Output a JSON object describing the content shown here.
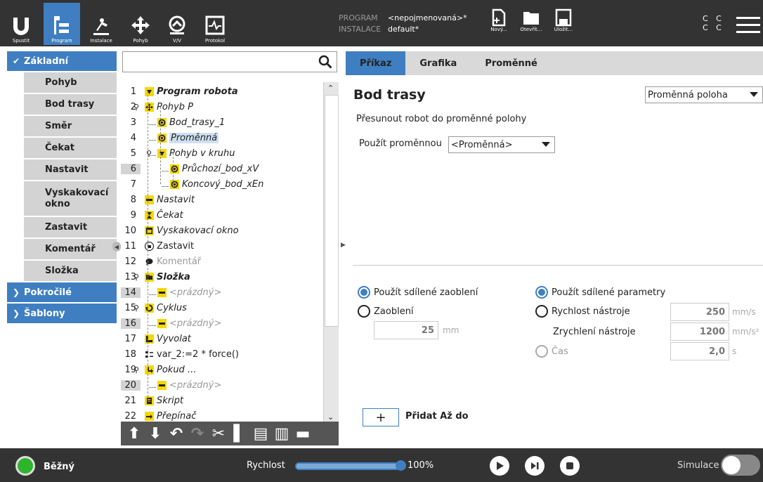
{
  "topbar": {
    "nav": [
      {
        "label": "Spustit",
        "icon": "ur-logo-icon"
      },
      {
        "label": "Program",
        "icon": "program-icon"
      },
      {
        "label": "Instalace",
        "icon": "installation-icon"
      },
      {
        "label": "Pohyb",
        "icon": "move-icon"
      },
      {
        "label": "V/V",
        "icon": "io-icon"
      },
      {
        "label": "Protokol",
        "icon": "log-icon"
      }
    ],
    "program_key": "PROGRAM",
    "program_value": "<nepojmenovaná>*",
    "installation_key": "INSTALACE",
    "installation_value": "default*",
    "file_buttons": [
      {
        "label": "Nový...",
        "icon": "new-file-icon"
      },
      {
        "label": "Otevřít...",
        "icon": "open-folder-icon"
      },
      {
        "label": "Uložit...",
        "icon": "save-icon"
      }
    ],
    "cc_top": "C C",
    "cc_bottom": "C C"
  },
  "sidebar": {
    "basic_label": "Základní",
    "basic_items": [
      "Pohyb",
      "Bod trasy",
      "Směr",
      "Čekat",
      "Nastavit",
      "Vyskakovací okno",
      "Zastavit",
      "Komentář",
      "Složka"
    ],
    "advanced_label": "Pokročilé",
    "templates_label": "Šablony"
  },
  "tree": {
    "search_placeholder": "",
    "rows": [
      {
        "num": "1",
        "text": "Program robota",
        "style": "bold-italic",
        "icon": "program-node-icon"
      },
      {
        "num": "2",
        "text": "Pohyb P",
        "style": "italic",
        "icon": "move-node-icon"
      },
      {
        "num": "3",
        "text": "Bod_trasy_1",
        "style": "italic",
        "icon": "waypoint-icon"
      },
      {
        "num": "4",
        "text": "Proměnná",
        "style": "italic-selected",
        "icon": "waypoint-icon"
      },
      {
        "num": "5",
        "text": "Pohyb v kruhu",
        "style": "italic",
        "icon": "program-node-icon"
      },
      {
        "num": "6",
        "text": "Průchozí_bod_xV",
        "style": "italic",
        "icon": "waypoint-icon"
      },
      {
        "num": "7",
        "text": "Koncový_bod_xEn",
        "style": "italic",
        "icon": "waypoint-icon"
      },
      {
        "num": "8",
        "text": "Nastavit",
        "style": "italic",
        "icon": "set-icon"
      },
      {
        "num": "9",
        "text": "Čekat",
        "style": "italic",
        "icon": "wait-icon"
      },
      {
        "num": "10",
        "text": "Vyskakovací okno",
        "style": "italic",
        "icon": "popup-icon"
      },
      {
        "num": "11",
        "text": "Zastavit",
        "style": "normal",
        "icon": "halt-icon"
      },
      {
        "num": "12",
        "text": "Komentář",
        "style": "gray",
        "icon": "comment-icon"
      },
      {
        "num": "13",
        "text": "Složka",
        "style": "bold-italic",
        "icon": "folder-icon"
      },
      {
        "num": "14",
        "text": "<prázdný>",
        "style": "gray-italic",
        "icon": "empty-icon"
      },
      {
        "num": "15",
        "text": "Cyklus",
        "style": "italic",
        "icon": "loop-icon"
      },
      {
        "num": "16",
        "text": "<prázdný>",
        "style": "gray-italic",
        "icon": "empty-icon"
      },
      {
        "num": "17",
        "text": "Vyvolat",
        "style": "italic",
        "icon": "call-icon"
      },
      {
        "num": "18",
        "text": "var_2:=2 * force()",
        "style": "normal",
        "icon": "assignment-icon"
      },
      {
        "num": "19",
        "text": "Pokud ...",
        "style": "italic",
        "icon": "if-icon"
      },
      {
        "num": "20",
        "text": "<prázdný>",
        "style": "gray-italic",
        "icon": "empty-icon"
      },
      {
        "num": "21",
        "text": "Skript",
        "style": "italic",
        "icon": "script-icon"
      },
      {
        "num": "22",
        "text": "Přepínač",
        "style": "italic",
        "icon": "switch-icon"
      }
    ]
  },
  "tabs": [
    "Příkaz",
    "Grafika",
    "Proměnné"
  ],
  "main": {
    "title": "Bod trasy",
    "waypoint_type": "Proměnná poloha",
    "description": "Přesunout robot do proměnné polohy",
    "use_var_label": "Použít proměnnou",
    "use_var_value": "<Proměnná>",
    "blend_shared_label": "Použít sdílené zaoblení",
    "blend_label": "Zaoblení",
    "blend_value": "25",
    "blend_unit": "mm",
    "params_shared_label": "Použít sdílené parametry",
    "tool_speed_label": "Rychlost nástroje",
    "tool_speed_value": "250",
    "tool_speed_unit": "mm/s",
    "tool_accel_label": "Zrychlení nástroje",
    "tool_accel_value": "1200",
    "tool_accel_unit": "mm/s²",
    "time_label": "Čas",
    "time_value": "2,0",
    "time_unit": "s",
    "add_button": "+",
    "add_label": "Přidat Až do"
  },
  "bottombar": {
    "status": "Běžný",
    "status_color": "#2db52d",
    "speed_label": "Rychlost",
    "speed_value": "100%",
    "speed_fraction": 1.0,
    "simulation_label": "Simulace"
  },
  "colors": {
    "accent": "#3f7fc1",
    "topbar": "#333333"
  }
}
